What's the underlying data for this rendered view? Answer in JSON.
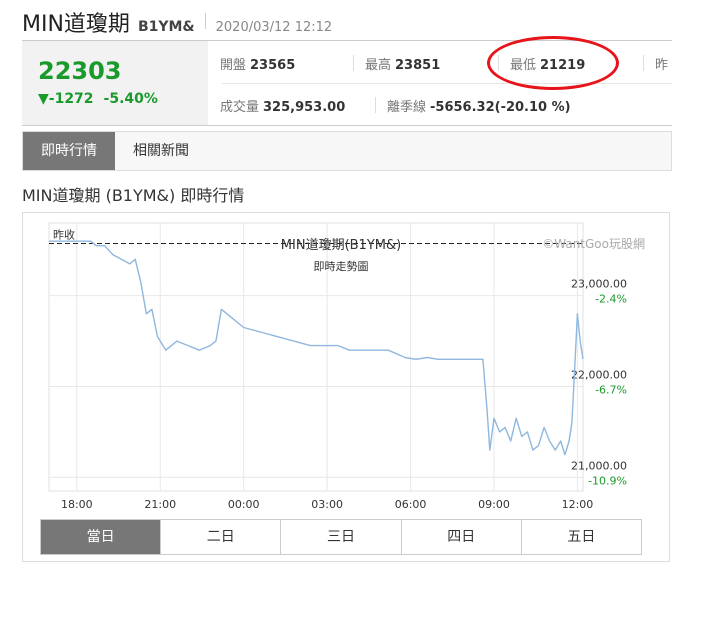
{
  "header": {
    "name": "MIN道瓊期",
    "code": "B1YM&",
    "datetime": "2020/03/12 12:12"
  },
  "quote": {
    "price": "22303",
    "change": "▼-1272",
    "change_pct": "-5.40%",
    "stats": [
      {
        "label": "開盤",
        "value": "23565"
      },
      {
        "label": "最高",
        "value": "23851"
      },
      {
        "label": "最低",
        "value": "21219"
      },
      {
        "label": "昨",
        "value": ""
      },
      {
        "label": "成交量",
        "value": "325,953.00"
      },
      {
        "label": "離季線",
        "value": "-5656.32(-20.10 %)"
      }
    ]
  },
  "tabs": [
    "即時行情",
    "相關新聞"
  ],
  "subtitle": "MIN道瓊期 (B1YM&) 即時行情",
  "range_tabs": [
    "當日",
    "二日",
    "三日",
    "四日",
    "五日"
  ],
  "colors": {
    "up": "#1a9a2a",
    "line": "#8fb7df",
    "annotation": "#e8141b",
    "active_tab": "#777777"
  },
  "chart_data": {
    "type": "line",
    "title": "MIN道瓊期(B1YM&)",
    "subtitle": "即時走勢圖",
    "watermark": "©WantGoo玩股網",
    "prev_close_label": "昨收",
    "prev_close": 23575,
    "x_ticks": [
      "18:00",
      "21:00",
      "00:00",
      "03:00",
      "06:00",
      "09:00",
      "12:00"
    ],
    "y_ticks": [
      {
        "value": 23000,
        "label": "23,000.00",
        "pct": "-2.4%"
      },
      {
        "value": 22000,
        "label": "22,000.00",
        "pct": "-6.7%"
      },
      {
        "value": 21000,
        "label": "21,000.00",
        "pct": "-10.9%"
      }
    ],
    "ylim": [
      20850,
      23800
    ],
    "hours_range": [
      17.0,
      12.2
    ],
    "series": [
      {
        "x": [
          17.0,
          18.0,
          18.5,
          18.7,
          19.0,
          19.3,
          19.6,
          19.9,
          20.1,
          20.3,
          20.5,
          20.7,
          20.9,
          21.2,
          21.6,
          22.0,
          22.4,
          22.8,
          23.0,
          23.2,
          23.6,
          24.0,
          24.6,
          25.2,
          25.8,
          26.4,
          27.0,
          27.4,
          27.8,
          28.2,
          28.6,
          29.2,
          29.8,
          30.2,
          30.6,
          31.0,
          31.6,
          32.0,
          32.4,
          32.6,
          32.75,
          32.85,
          33.0,
          33.2,
          33.4,
          33.6,
          33.8,
          34.0,
          34.2,
          34.4,
          34.6,
          34.8,
          35.0,
          35.2,
          35.4,
          35.55,
          35.7,
          35.8,
          35.9,
          36.0,
          36.1,
          36.2
        ],
        "y": [
          23600,
          23600,
          23600,
          23550,
          23550,
          23450,
          23400,
          23350,
          23400,
          23150,
          22800,
          22850,
          22550,
          22400,
          22500,
          22450,
          22400,
          22450,
          22500,
          22850,
          22750,
          22650,
          22600,
          22550,
          22500,
          22450,
          22450,
          22450,
          22400,
          22400,
          22400,
          22400,
          22320,
          22300,
          22320,
          22300,
          22300,
          22300,
          22300,
          22300,
          21750,
          21300,
          21650,
          21500,
          21550,
          21400,
          21650,
          21450,
          21500,
          21300,
          21350,
          21550,
          21400,
          21300,
          21400,
          21250,
          21400,
          21600,
          22200,
          22800,
          22500,
          22303
        ]
      }
    ]
  }
}
